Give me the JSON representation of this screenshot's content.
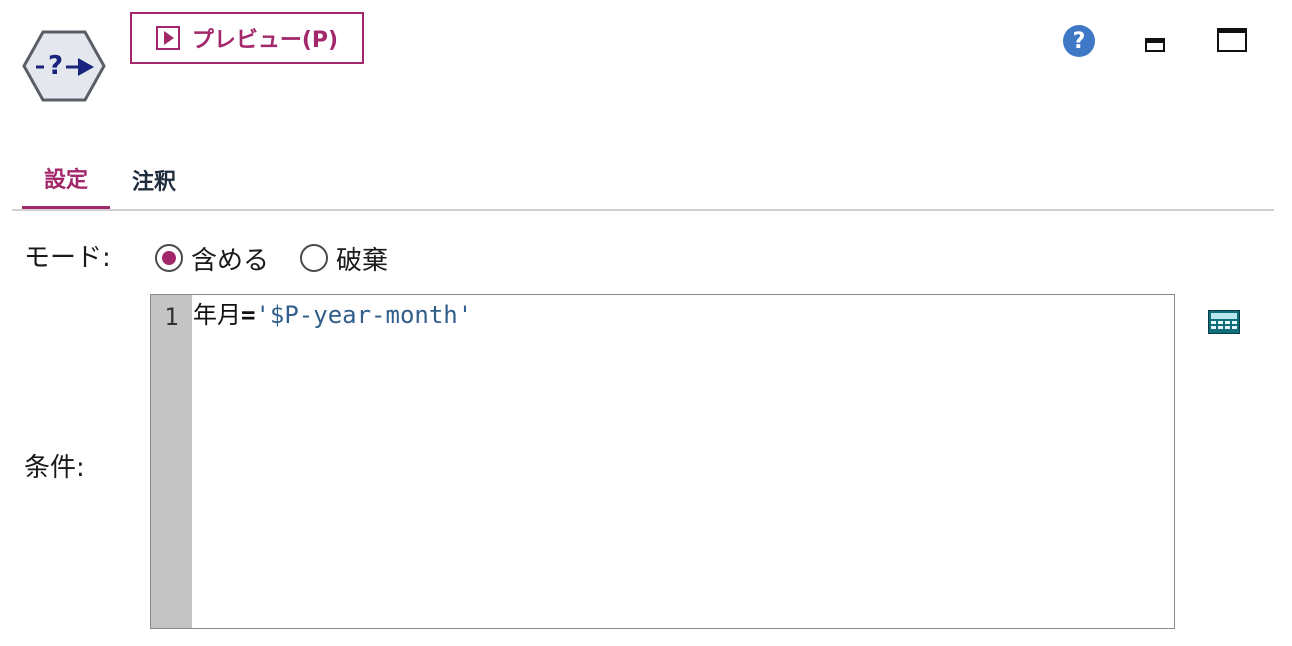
{
  "header": {
    "preview_label": "プレビュー(P)"
  },
  "tabs": [
    {
      "label": "設定",
      "active": true
    },
    {
      "label": "注釈",
      "active": false
    }
  ],
  "mode": {
    "label": "モード:",
    "options": [
      {
        "label": "含める",
        "selected": true
      },
      {
        "label": "破棄",
        "selected": false
      }
    ]
  },
  "condition": {
    "label": "条件:",
    "line_number": "1",
    "tokens": {
      "identifier": "年月",
      "operator": "=",
      "string": "'$P-year-month'"
    }
  },
  "colors": {
    "accent": "#a3286b",
    "help": "#3f78c6",
    "string": "#2f5f8a",
    "gutter": "#c4c4c4"
  },
  "icons": {
    "node": "select-node-icon",
    "help": "help-icon",
    "minimize": "minimize-icon",
    "maximize": "maximize-icon",
    "expression_builder": "expression-builder-icon"
  }
}
